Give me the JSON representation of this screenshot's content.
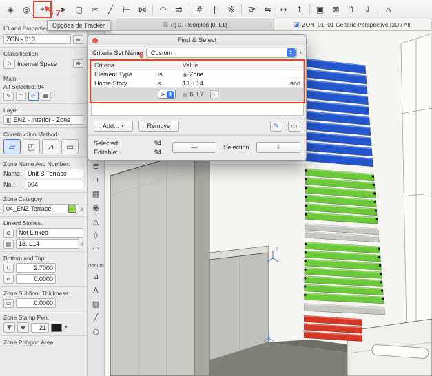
{
  "colors": {
    "accent_blue": "#3b7cf5",
    "annotation_red": "#e8432d",
    "swatch_green": "#8bd04a",
    "pen_black": "#1b1b1b"
  },
  "tooltip": {
    "label": "Opções de Tracker"
  },
  "annotations": {
    "tracker": "7",
    "criteria": "8"
  },
  "icons": {
    "move-icon": "◈",
    "zoom-options-icon": "◎",
    "tracker-options-icon": "⌖",
    "arrow-tool-icon": "➤",
    "marquee-select-icon": "▢",
    "marquee-tool-icon": "▢",
    "trim-icon": "✂",
    "split-icon": "╱",
    "adjust-icon": "⊢",
    "intersect-icon": "⋈",
    "fillet-icon": "◠",
    "offset-icon": "⇉",
    "grid-snap-icon": "#",
    "guide-lines-icon": "∥",
    "snap-points-icon": "※",
    "rotate-icon": "⟳",
    "mirror-icon": "⇋",
    "stretch-icon": "↔",
    "elevate-icon": "↥",
    "group-icon": "▣",
    "lock-icon": "⊠",
    "bring-forward-icon": "⇑",
    "send-backward-icon": "⇓",
    "home-icon": "⌂",
    "wall-tool-icon": "▤",
    "door-tool-icon": "◫",
    "window-tool-icon": "⊞",
    "column-tool-icon": "▮",
    "beam-tool-icon": "▬",
    "slab-tool-icon": "▱",
    "roof-tool-icon": "⌂",
    "stair-tool-icon": "≣",
    "railing-tool-icon": "⊓",
    "curtain-wall-tool-icon": "▦",
    "zone-tool-icon": "◉",
    "mesh-tool-icon": "△",
    "morph-tool-icon": "◊",
    "shell-tool-icon": "◠",
    "dimension-tool-icon": "⊿",
    "text-tool-icon": "A",
    "fill-tool-icon": "▨",
    "line-tool-icon": "╱",
    "circle-tool-icon": "○",
    "views-grid-icon": "⊞",
    "layouts-grid-icon": "⊡",
    "floorplan-icon": "▤",
    "cube-3d-icon": "◪",
    "menu-icon": "≡",
    "space-icon": "⌂",
    "plus-circle-icon": "⊕",
    "pen-icon": "✎",
    "refresh-icon": "⟳",
    "grid-small-icon": "▦",
    "chevron-right-icon": "›",
    "layer-icon": "◧",
    "constr-box-icon": "▱",
    "constr-corner-icon": "◰",
    "constr-wedge-icon": "⊿",
    "constr-slab-icon": "▭",
    "unlink-icon": "⊘",
    "story-icon": "▤",
    "bottom-level-icon": "∟",
    "top-level-icon": "⌐",
    "subfloor-icon": "▭",
    "pen-box-icon": "▼",
    "pen-box2-icon": "◆",
    "caret-down-icon": "▾",
    "zone-icon": "◉",
    "eyedropper-icon": "✎",
    "marquee-arrow-icon": "▭"
  },
  "toolbar": {
    "icons": [
      "move-icon",
      "zoom-options-icon",
      "tracker-options-icon",
      "sep",
      "arrow-tool-icon",
      "marquee-select-icon",
      "trim-icon",
      "split-icon",
      "adjust-icon",
      "intersect-icon",
      "sep",
      "fillet-icon",
      "offset-icon",
      "sep",
      "grid-snap-icon",
      "guide-lines-icon",
      "snap-points-icon",
      "sep",
      "rotate-icon",
      "mirror-icon",
      "stretch-icon",
      "elevate-icon",
      "sep",
      "group-icon",
      "lock-icon",
      "bring-forward-icon",
      "send-backward-icon",
      "sep",
      "home-icon"
    ]
  },
  "quickbar": {
    "icons": [
      "views-grid-icon",
      "layouts-grid-icon"
    ]
  },
  "tabs": {
    "floorplan": {
      "label": "(!) 0. Floorplan [0. L1]"
    },
    "perspective": {
      "label": "ZON_01_01 Generic Perspective [3D / All]"
    }
  },
  "panel": {
    "id_section_label": "ID and Properties:",
    "id_value": "ZON - 013",
    "classification_label": "Classification:",
    "classification_value": "Internal Space",
    "main_label": "Main:",
    "all_selected_label": "All Selected: 94",
    "layer_label": "Layer:",
    "layer_value": "ENZ - Interior - Zone",
    "construction_label": "Construction Method:",
    "zone_name_label": "Zone Name And Number:",
    "name_label": "Name:",
    "name_value": "Unit B Terrace",
    "no_label": "No.:",
    "no_value": "004",
    "category_label": "Zone Category:",
    "category_value": "04_ENZ Terrace",
    "linked_label": "Linked Stories:",
    "linked_value": "Not Linked",
    "linked_story_value": "13. L14",
    "bottom_top_label": "Bottom and Top:",
    "bottom_value": "2.7000",
    "top_value": "0.0000",
    "subfloor_label": "Zone Subfloor Thickness:",
    "subfloor_value": "0.0000",
    "stamp_pen_label": "Zone Stamp Pen:",
    "stamp_pen_value": "21",
    "polygon_area_label": "Zone Polygon Area:"
  },
  "toolbox": {
    "icons_top": [
      "arrow-tool-icon",
      "marquee-tool-icon",
      "wall-tool-icon",
      "door-tool-icon",
      "window-tool-icon",
      "column-tool-icon",
      "beam-tool-icon",
      "slab-tool-icon",
      "roof-tool-icon",
      "stair-tool-icon",
      "railing-tool-icon",
      "curtain-wall-tool-icon",
      "zone-tool-icon",
      "mesh-tool-icon",
      "morph-tool-icon",
      "shell-tool-icon"
    ],
    "divider_label": "Docum",
    "icons_bottom": [
      "dimension-tool-icon",
      "text-tool-icon",
      "fill-tool-icon",
      "line-tool-icon",
      "circle-tool-icon"
    ]
  },
  "dialog": {
    "title": "Find & Select",
    "criteria_set_label": "Criteria Set Name:",
    "criteria_set_value": "Custom",
    "col_criteria": "Criteria",
    "col_value": "Value",
    "rows": [
      {
        "criteria": "Element Type",
        "op": "is",
        "value": "Zone",
        "conj": ""
      },
      {
        "criteria": "Home Story",
        "op": "≤",
        "value": "13. L14",
        "conj": "and"
      },
      {
        "criteria": "",
        "op": "≥",
        "value": "6. L7",
        "conj": ""
      }
    ],
    "add_label": "Add...",
    "remove_label": "Remove",
    "selected_label": "Selected:",
    "selected_value": "94",
    "editable_label": "Editable:",
    "editable_value": "94",
    "minus_label": "—",
    "selection_label": "Selection",
    "plus_label": "+"
  },
  "scene": {
    "tower_sections": [
      {
        "name": "zone-block-blue",
        "color": "#2457ce",
        "top": "#5d8bf2",
        "floors": 10,
        "t0": 0.0,
        "t1": 0.37,
        "dots": false
      },
      {
        "name": "zone-block-green-upper",
        "color": "#6cc93a",
        "top": "#9bde6e",
        "floors": 6,
        "t0": 0.39,
        "t1": 0.575,
        "dots": true
      },
      {
        "name": "slab-gray-upper",
        "color": "#c6c6c2",
        "top": "#e2e2de",
        "floors": 2,
        "t0": 0.585,
        "t1": 0.64,
        "dots": false
      },
      {
        "name": "zone-block-green-lower",
        "color": "#6cc93a",
        "top": "#9bde6e",
        "floors": 7,
        "t0": 0.65,
        "t1": 0.86,
        "dots": true
      },
      {
        "name": "slab-gray-lower",
        "color": "#c6c6c2",
        "top": "#e2e2de",
        "floors": 1,
        "t0": 0.868,
        "t1": 0.9,
        "dots": false
      },
      {
        "name": "zone-block-red",
        "color": "#d53826",
        "top": "#ee6a52",
        "floors": 3,
        "t0": 0.91,
        "t1": 0.995,
        "dots": false,
        "narrow": true
      }
    ]
  }
}
